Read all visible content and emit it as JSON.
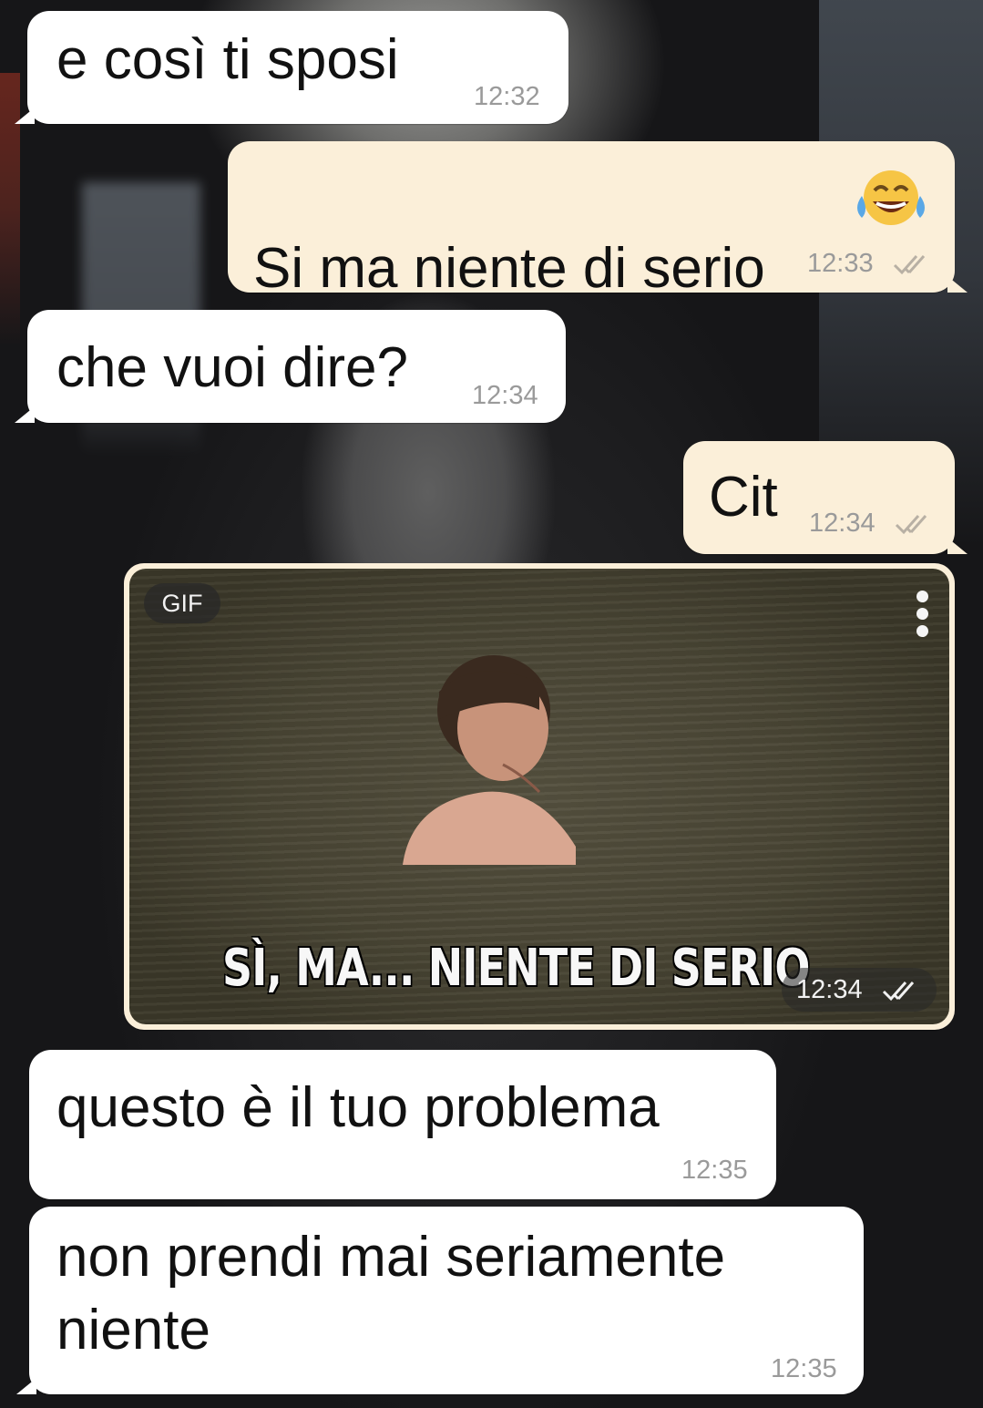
{
  "messages": [
    {
      "direction": "in",
      "text": "e così ti sposi",
      "time": "12:32"
    },
    {
      "direction": "out",
      "text": "Si ma niente di serio",
      "emoji": "😂",
      "time": "12:33",
      "status": "read"
    },
    {
      "direction": "in",
      "text": "che vuoi dire?",
      "time": "12:34"
    },
    {
      "direction": "out",
      "text": "Cit",
      "time": "12:34",
      "status": "read"
    },
    {
      "direction": "out",
      "type": "gif",
      "badge": "GIF",
      "caption": "SÌ, MA... NIENTE DI SERIO",
      "time": "12:34",
      "status": "read"
    },
    {
      "direction": "in",
      "text": "questo è il tuo problema",
      "time": "12:35"
    },
    {
      "direction": "in",
      "text": "non prendi mai seriamente\nniente",
      "time": "12:35"
    }
  ],
  "colors": {
    "incoming_bubble": "#ffffff",
    "outgoing_bubble": "#fbefd9",
    "timestamp": "#9a9a9a",
    "read_ticks": "#b8b0a4"
  },
  "icons": {
    "status_read": "double-check-icon",
    "gif_menu": "more-vertical-icon"
  }
}
